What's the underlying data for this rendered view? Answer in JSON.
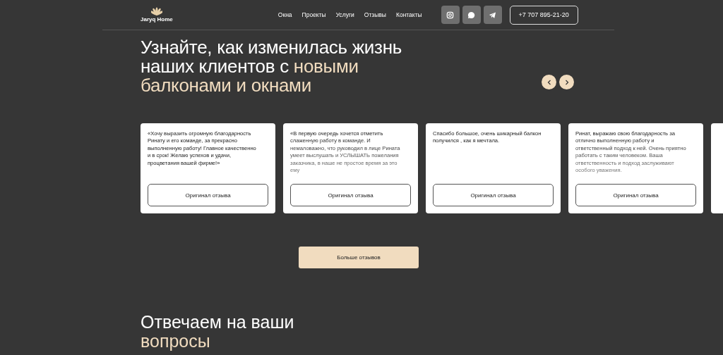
{
  "header": {
    "logo": "Jaryq Home",
    "nav": [
      "Окна",
      "Проекты",
      "Услуги",
      "Отзывы",
      "Контакты"
    ],
    "phone": "+7 707 895-21-20"
  },
  "reviews": {
    "title": "Узнайте, как изменилась жизнь наших клиентов с ",
    "title_accent": "новыми балконами и окнами",
    "cards": [
      {
        "text": "«Хочу выразить огромную благодарность Ринату и его команде, за прекрасно выполненную работу! Главное качественно и в срок!  Желаю успехов и удачи, процветания вашей фирме!»",
        "faded": false,
        "button": "Оригинал отзыва"
      },
      {
        "text": "«В первую очередь хочется отметить слаженную работу в команде. И немаловажно, что руководил в лице Рината умеет выслушать и УСЛЫШАТЬ пожелания заказчика, в наше не простое время за это ему",
        "faded": true,
        "button": "Оригинал отзыва"
      },
      {
        "text": "Спасибо большое, очень шикарный балкон получился , как я мечтала.",
        "faded": false,
        "button": "Оригинал отзыва"
      },
      {
        "text": "Ринат, выражаю свою благодарность за отлично выполненную работу и ответственный подход к ней. Очень приятно работать с таким человеком. Ваша ответственность и подход заслуживают особого уважения.",
        "faded": true,
        "button": "Оригинал отзыва"
      }
    ],
    "more": "Больше отзывов"
  },
  "faq": {
    "title": "Отвечаем на ваши ",
    "title_accent": "вопросы"
  }
}
